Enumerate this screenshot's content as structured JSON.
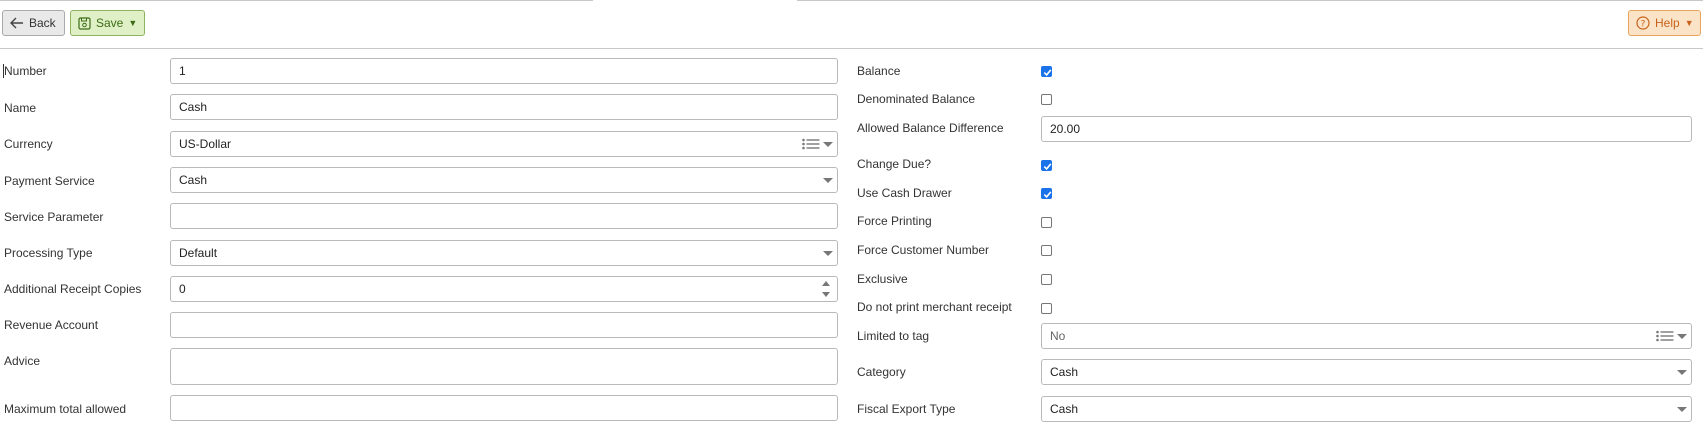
{
  "toolbar": {
    "back_label": "Back",
    "save_label": "Save",
    "help_label": "Help"
  },
  "left_form": {
    "number": {
      "label": "Number",
      "value": "1"
    },
    "name": {
      "label": "Name",
      "value": "Cash"
    },
    "currency": {
      "label": "Currency",
      "value": "US-Dollar"
    },
    "payment_service": {
      "label": "Payment Service",
      "value": "Cash"
    },
    "service_parameter": {
      "label": "Service Parameter",
      "value": ""
    },
    "processing_type": {
      "label": "Processing Type",
      "value": "Default"
    },
    "additional_receipt_copies": {
      "label": "Additional Receipt Copies",
      "value": "0"
    },
    "revenue_account": {
      "label": "Revenue Account",
      "value": ""
    },
    "advice": {
      "label": "Advice",
      "value": ""
    },
    "maximum_total_allowed": {
      "label": "Maximum total allowed",
      "value": ""
    }
  },
  "right_form": {
    "balance": {
      "label": "Balance",
      "checked": true
    },
    "denominated_balance": {
      "label": "Denominated Balance",
      "checked": false
    },
    "allowed_balance_difference": {
      "label": "Allowed Balance Difference",
      "value": "20.00"
    },
    "change_due": {
      "label": "Change Due?",
      "checked": true
    },
    "use_cash_drawer": {
      "label": "Use Cash Drawer",
      "checked": true
    },
    "force_printing": {
      "label": "Force Printing",
      "checked": false
    },
    "force_customer_number": {
      "label": "Force Customer Number",
      "checked": false
    },
    "exclusive": {
      "label": "Exclusive",
      "checked": false
    },
    "do_not_print_merchant_receipt": {
      "label": "Do not print merchant receipt",
      "checked": false
    },
    "limited_to_tag": {
      "label": "Limited to tag",
      "value": "No"
    },
    "category": {
      "label": "Category",
      "value": "Cash"
    },
    "fiscal_export_type": {
      "label": "Fiscal Export Type",
      "value": "Cash"
    }
  },
  "colors": {
    "checkbox_checked": "#1a73e8",
    "save_button_bg": "#dff0c7",
    "help_button_bg": "#fbe3c8"
  },
  "icons": {
    "back": "arrow-left-icon",
    "save": "save-disk-icon",
    "help": "question-circle-icon",
    "list": "list-icon",
    "dropdown": "chevron-down-icon"
  }
}
